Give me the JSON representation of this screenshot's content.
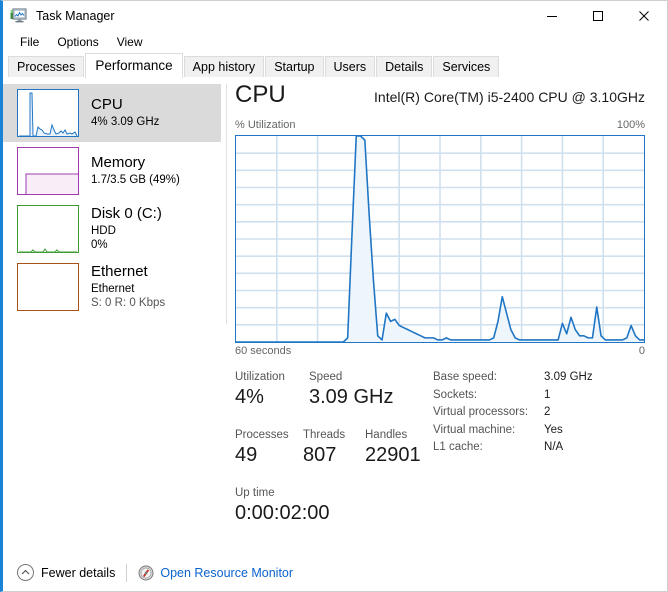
{
  "window": {
    "title": "Task Manager",
    "icon": "task-manager-monitor-icon",
    "accent_color": "#1883d7",
    "controls": {
      "minimize": "minimize-icon",
      "maximize": "maximize-icon",
      "close": "close-icon"
    }
  },
  "menu": {
    "items": [
      "File",
      "Options",
      "View"
    ]
  },
  "tabs": {
    "items": [
      {
        "label": "Processes",
        "active": false
      },
      {
        "label": "Performance",
        "active": true
      },
      {
        "label": "App history",
        "active": false
      },
      {
        "label": "Startup",
        "active": false
      },
      {
        "label": "Users",
        "active": false
      },
      {
        "label": "Details",
        "active": false
      },
      {
        "label": "Services",
        "active": false
      }
    ]
  },
  "sidebar": {
    "items": [
      {
        "name": "CPU",
        "title": "CPU",
        "sub1": "4%  3.09 GHz",
        "sub2": "",
        "color": "#2076c4",
        "selected": true
      },
      {
        "name": "Memory",
        "title": "Memory",
        "sub1": "1.7/3.5 GB (49%)",
        "sub2": "",
        "color": "#a23ab0",
        "selected": false
      },
      {
        "name": "Disk 0 (C:)",
        "title": "Disk 0 (C:)",
        "sub1": "HDD",
        "sub2": "0%",
        "color": "#3f9c35",
        "selected": false
      },
      {
        "name": "Ethernet",
        "title": "Ethernet",
        "sub1": "Ethernet",
        "sub2": "S: 0 R: 0 Kbps",
        "color": "#a8521a",
        "selected": false
      }
    ]
  },
  "main": {
    "heading": "CPU",
    "model": "Intel(R) Core(TM) i5-2400 CPU @ 3.10GHz",
    "axis": {
      "y_label": "% Utilization",
      "y_max": "100%",
      "x_left": "60 seconds",
      "x_right": "0"
    },
    "graph_color": "#2076c4",
    "graph_fill": "#eef5fb",
    "grid_color": "#cfe0ef",
    "stats_left": [
      {
        "label": "Utilization",
        "value": "4%"
      },
      {
        "label": "Speed",
        "value": "3.09 GHz"
      }
    ],
    "stats_mid": [
      {
        "label": "Processes",
        "value": "49"
      },
      {
        "label": "Threads",
        "value": "807"
      },
      {
        "label": "Handles",
        "value": "22901"
      }
    ],
    "uptime": {
      "label": "Up time",
      "value": "0:00:02:00"
    },
    "details": [
      {
        "key": "Base speed:",
        "value": "3.09 GHz"
      },
      {
        "key": "Sockets:",
        "value": "1"
      },
      {
        "key": "Virtual processors:",
        "value": "2"
      },
      {
        "key": "Virtual machine:",
        "value": "Yes"
      },
      {
        "key": "L1 cache:",
        "value": "N/A"
      }
    ]
  },
  "footer": {
    "fewer_details": "Fewer details",
    "fewer_icon": "chevron-up-circle-icon",
    "resource_monitor": "Open Resource Monitor",
    "resource_monitor_icon": "resource-monitor-icon",
    "link_color": "#0b63ce"
  },
  "chart_data": {
    "type": "area",
    "title": "CPU % Utilization",
    "xlabel": "60 seconds",
    "ylabel": "% Utilization",
    "ylim": [
      0,
      100
    ],
    "xlim": [
      60,
      0
    ],
    "grid": true,
    "grid_cols": 10,
    "grid_rows": 6,
    "legend": "none",
    "series": [
      {
        "name": "CPU Utilization",
        "color": "#2076c4",
        "values": [
          0,
          0,
          0,
          0,
          0,
          0,
          0,
          0,
          0,
          0,
          0,
          0,
          0,
          0,
          0,
          0,
          0,
          0,
          0,
          0,
          0,
          0,
          0,
          0,
          0,
          0,
          2,
          52,
          100,
          100,
          98,
          62,
          30,
          3,
          1,
          14,
          10,
          11,
          8,
          7,
          6,
          5,
          4,
          3,
          2,
          2,
          2,
          1,
          1,
          2,
          1,
          1,
          1,
          1,
          1,
          1,
          1,
          1,
          1,
          1,
          2,
          10,
          22,
          14,
          6,
          2,
          1,
          1,
          1,
          1,
          1,
          1,
          1,
          1,
          1,
          1,
          9,
          4,
          12,
          6,
          3,
          3,
          2,
          2,
          17,
          3,
          1,
          1,
          1,
          1,
          1,
          2,
          8,
          3,
          1,
          1
        ]
      }
    ]
  }
}
